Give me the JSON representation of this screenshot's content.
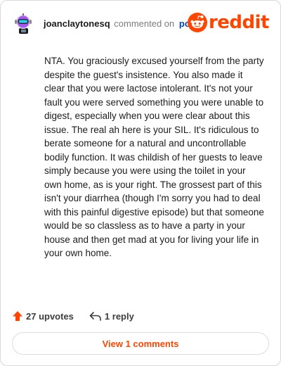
{
  "header": {
    "username": "joanclaytonesq",
    "commented_text": "commented on",
    "post_link": "post",
    "logo_text": "reddit"
  },
  "comment": {
    "text": "NTA. You graciously excused yourself from the party despite the guest's insistence. You also made it clear that you were lactose intolerant. It's not your fault you were served something you were unable to digest, especially when you were clear about this issue. The real ah here is your SIL. It's ridiculous to berate someone for a natural and uncontrollable bodily function. It was childish of her guests to leave simply because you were using the toilet in your own home, as is your right. The grossest part of this isn't your diarrhea (though I'm sorry you had to deal with this painful digestive episode) but that someone would be so classless as to have a party in your house and then get mad at you for living your life in your own home."
  },
  "actions": {
    "upvotes": "27 upvotes",
    "replies": "1 reply"
  },
  "view_comments": "View 1 comments",
  "icons": {
    "avatar": "snoo-avatar-icon",
    "logo": "reddit-alien-icon",
    "upvote": "upvote-arrow-icon",
    "reply": "reply-arrow-icon"
  },
  "colors": {
    "brand": "#ff4500",
    "link": "#0045ac",
    "border": "#d8d8d8"
  }
}
